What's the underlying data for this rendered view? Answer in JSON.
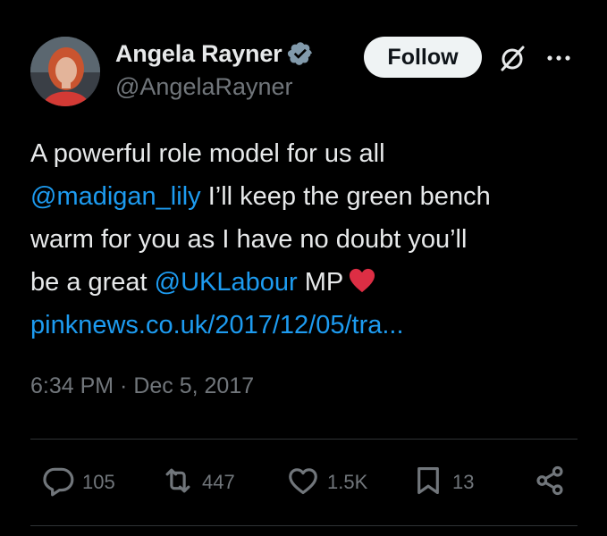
{
  "author": {
    "display_name": "Angela Rayner",
    "handle": "@AngelaRayner",
    "verified": true
  },
  "header": {
    "follow_label": "Follow"
  },
  "tweet": {
    "line1": "A powerful role model for us all",
    "line2_mention": "@madigan_lily",
    "line2_rest": " I’ll keep the green bench",
    "line3": "warm for you as I have no doubt you’ll",
    "line4_pre": "be a great ",
    "line4_mention": "@UKLabour",
    "line4_post": " MP",
    "link": "pinknews.co.uk/2017/12/05/tra..."
  },
  "meta": {
    "timestamp": "6:34 PM · Dec 5, 2017"
  },
  "actions": {
    "replies": "105",
    "reposts": "447",
    "likes": "1.5K",
    "bookmarks": "13"
  },
  "colors": {
    "background": "#000000",
    "text": "#e7e9ea",
    "muted": "#71767b",
    "link": "#1d9bf0",
    "verified": "#829aab",
    "heart": "#dd2e44"
  },
  "icons": {
    "verified": "verified-badge-icon",
    "grok": "grok-icon",
    "more": "more-icon",
    "reply": "reply-icon",
    "repost": "repost-icon",
    "like": "like-icon",
    "bookmark": "bookmark-icon",
    "share": "share-icon",
    "heart_emoji": "red-heart-emoji"
  }
}
